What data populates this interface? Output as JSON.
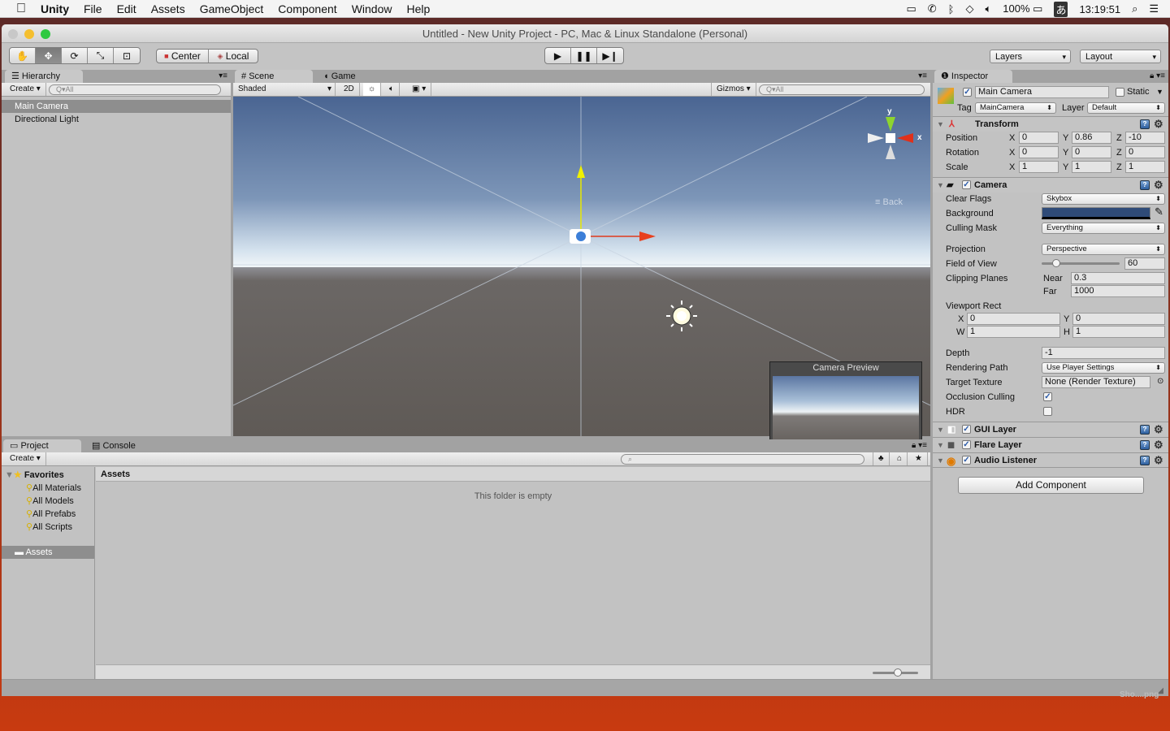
{
  "menubar": {
    "apple": "",
    "app": "Unity",
    "items": [
      "File",
      "Edit",
      "Assets",
      "GameObject",
      "Component",
      "Window",
      "Help"
    ],
    "battery": "100%",
    "input_method": "あ",
    "clock": "13:19:51"
  },
  "window": {
    "title": "Untitled - New Unity Project - PC, Mac & Linux Standalone (Personal)"
  },
  "toolbar": {
    "pivot": "Center",
    "space": "Local",
    "layers": "Layers",
    "layout": "Layout"
  },
  "hierarchy": {
    "tab": "Hierarchy",
    "create": "Create",
    "search": "All",
    "items": [
      "Main Camera",
      "Directional Light"
    ],
    "selected": 0
  },
  "scene": {
    "tabs": [
      "Scene",
      "Game"
    ],
    "shading": "Shaded",
    "mode2d": "2D",
    "gizmos": "Gizmos",
    "search": "All",
    "gizmo_y": "y",
    "gizmo_x": "x",
    "view_label": "Back",
    "preview_title": "Camera Preview"
  },
  "project": {
    "tabs": [
      "Project",
      "Console"
    ],
    "create": "Create",
    "favorites_label": "Favorites",
    "favorites": [
      "All Materials",
      "All Models",
      "All Prefabs",
      "All Scripts"
    ],
    "assets_label": "Assets",
    "breadcrumb": "Assets",
    "empty_text": "This folder is empty",
    "overlay_file": "Sho....png"
  },
  "inspector": {
    "tab": "Inspector",
    "object_name": "Main Camera",
    "static_label": "Static",
    "tag_label": "Tag",
    "tag": "MainCamera",
    "layer_label": "Layer",
    "layer": "Default",
    "transform": {
      "title": "Transform",
      "rows": [
        {
          "label": "Position",
          "x": "0",
          "y": "0.86",
          "z": "-10"
        },
        {
          "label": "Rotation",
          "x": "0",
          "y": "0",
          "z": "0"
        },
        {
          "label": "Scale",
          "x": "1",
          "y": "1",
          "z": "1"
        }
      ]
    },
    "camera": {
      "title": "Camera",
      "clear_flags_label": "Clear Flags",
      "clear_flags": "Skybox",
      "background_label": "Background",
      "background_color": "#2f4b78",
      "culling_mask_label": "Culling Mask",
      "culling_mask": "Everything",
      "projection_label": "Projection",
      "projection": "Perspective",
      "fov_label": "Field of View",
      "fov": "60",
      "fov_fraction": 0.19,
      "clipping_label": "Clipping Planes",
      "near_label": "Near",
      "near": "0.3",
      "far_label": "Far",
      "far": "1000",
      "viewport_label": "Viewport Rect",
      "vx": "0",
      "vy": "0",
      "vw": "1",
      "vh": "1",
      "depth_label": "Depth",
      "depth": "-1",
      "rendering_path_label": "Rendering Path",
      "rendering_path": "Use Player Settings",
      "target_texture_label": "Target Texture",
      "target_texture": "None (Render Texture)",
      "occlusion_label": "Occlusion Culling",
      "occlusion": true,
      "hdr_label": "HDR",
      "hdr": false
    },
    "components": [
      "GUI Layer",
      "Flare Layer",
      "Audio Listener"
    ],
    "add_component": "Add Component"
  }
}
